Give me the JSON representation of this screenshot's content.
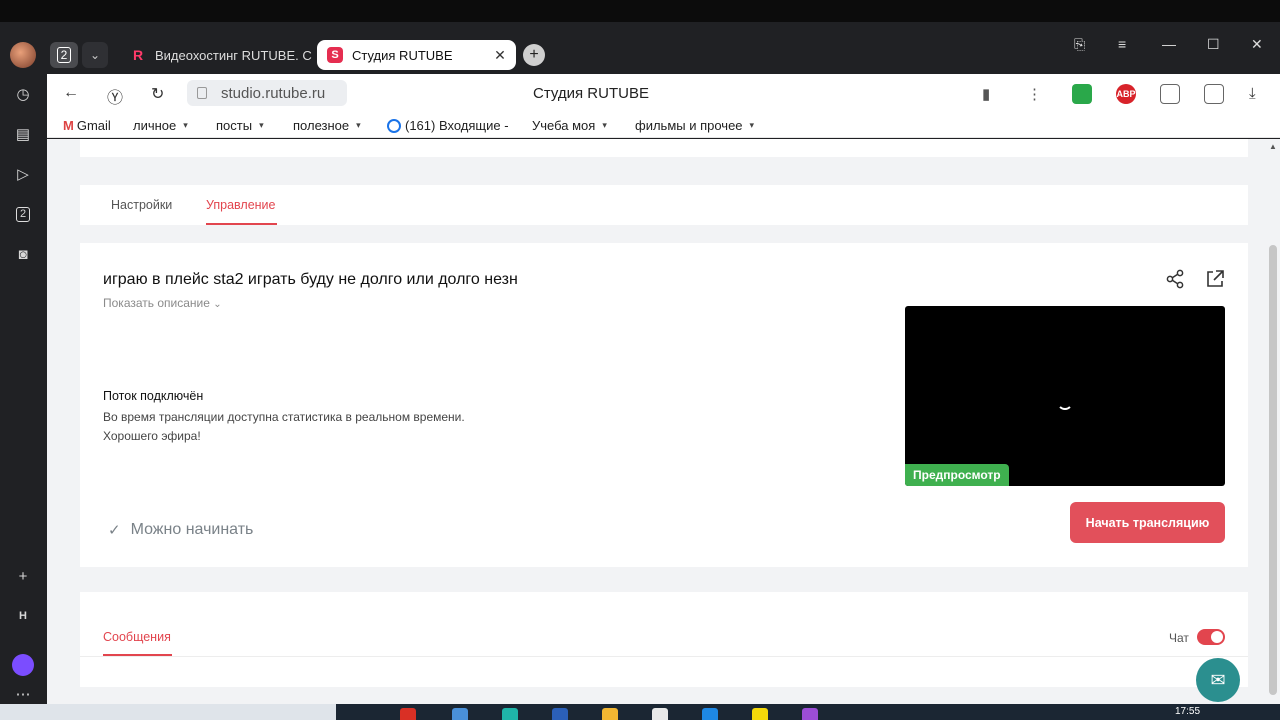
{
  "browser": {
    "tab_count": "2",
    "tabs": [
      {
        "title": "Видеохостинг RUTUBE. С",
        "favicon": "R"
      },
      {
        "title": "Студия RUTUBE",
        "favicon": "S"
      }
    ],
    "url": "studio.rutube.ru",
    "page_title": "Студия RUTUBE"
  },
  "bookmarks": [
    {
      "label": "Gmail",
      "has_menu": false
    },
    {
      "label": "личное",
      "has_menu": true
    },
    {
      "label": "посты",
      "has_menu": true
    },
    {
      "label": "полезное",
      "has_menu": true
    },
    {
      "label": "(161) Входящие -",
      "has_menu": false
    },
    {
      "label": "Учеба моя",
      "has_menu": true
    },
    {
      "label": "фильмы и прочее",
      "has_menu": true
    }
  ],
  "extensions": [
    {
      "name": "shield-extension",
      "color": "#2aa84a",
      "label": ""
    },
    {
      "name": "adblock-extension",
      "color": "#d8232a",
      "label": "ABP"
    }
  ],
  "sidebar": {
    "yandex_badge": "2",
    "h_label": "H"
  },
  "studio": {
    "tabs": [
      "Настройки",
      "Управление"
    ],
    "active_tab": "Управление",
    "stream_title": "играю в плейс sta2 играть буду не долго или долго незн",
    "show_description": "Показать описание",
    "status_heading": "Поток подключён",
    "status_lines": [
      "Во время трансляции доступна статистика в реальном времени.",
      "Хорошего эфира!"
    ],
    "preview_label": "Предпросмотр",
    "ready_text": "Можно начинать",
    "start_button": "Начать трансляцию",
    "messages_tab": "Сообщения",
    "chat_label": "Чат",
    "chat_enabled": true,
    "accent_color": "#e2454e"
  },
  "taskbar": {
    "time": "17:55"
  }
}
